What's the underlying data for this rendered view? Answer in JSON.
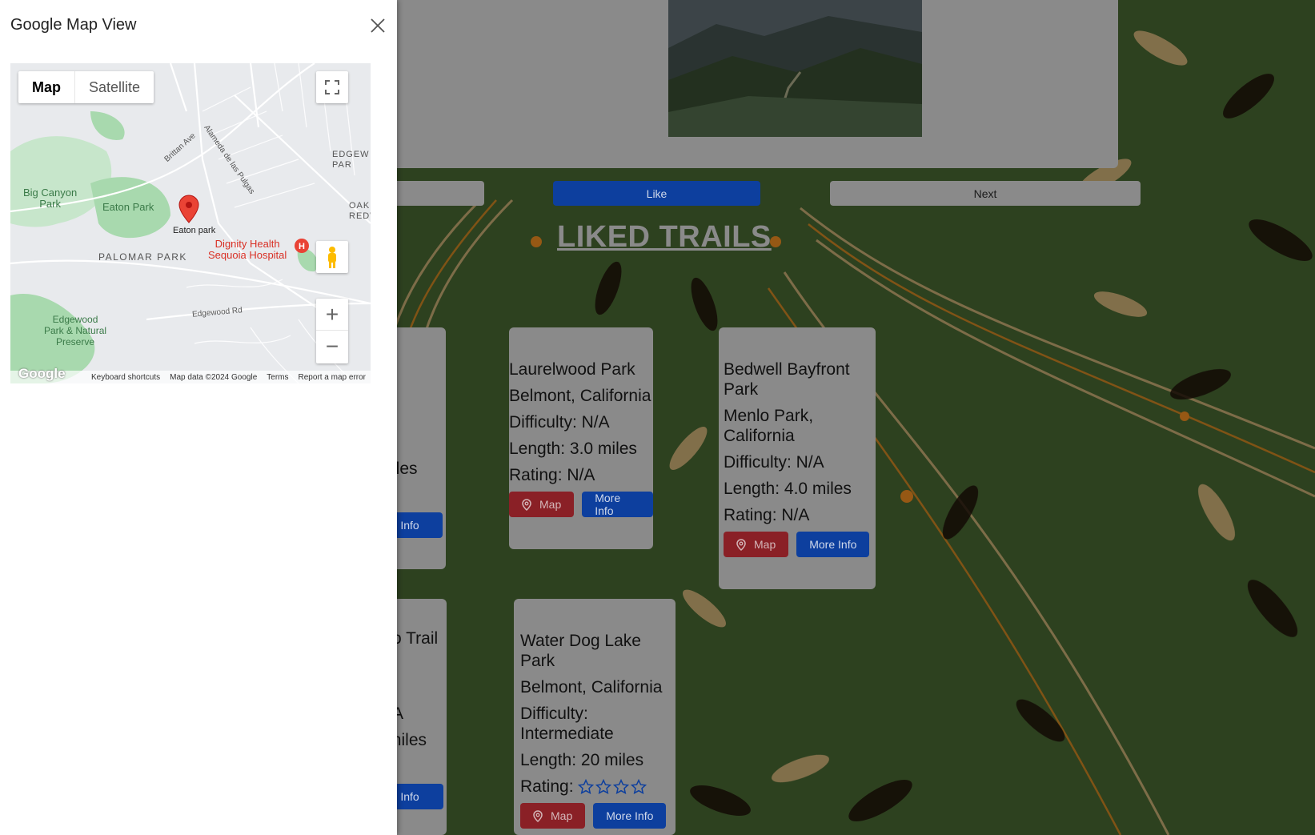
{
  "panel": {
    "title": "Google Map View"
  },
  "map": {
    "type_map": "Map",
    "type_satellite": "Satellite",
    "labels": {
      "big_canyon": "Big Canyon\nPark",
      "eaton_park_area": "Eaton Park",
      "eaton_marker": "Eaton park",
      "palomar": "PALOMAR PARK",
      "hospital": "Dignity Health\nSequoia Hospital",
      "edgewood_preserve": "Edgewood\nPark & Natural\nPreserve",
      "edgewood_rd": "Edgewood Rd",
      "brittan": "Brittan Ave",
      "alameda": "Alameda de las Pulgas",
      "edgew_par": "EDGEW\nPAR",
      "oak_redw": "OAK\nREDW"
    },
    "logo": "Google",
    "attribution": [
      "Keyboard shortcuts",
      "Map data ©2024 Google",
      "Terms",
      "Report a map error"
    ]
  },
  "controls": {
    "prev": "",
    "like": "Like",
    "next": "Next"
  },
  "heading": "LIKED TRAILS",
  "cards": [
    {
      "name": "Laurelwood Park",
      "location": "Belmont, California",
      "difficulty": "Difficulty: N/A",
      "length": "Length: 3.0 miles",
      "rating": "Rating: N/A",
      "map_btn": "Map",
      "info_btn": "More Info"
    },
    {
      "name": "Bedwell Bayfront Park",
      "location": "Menlo Park, California",
      "difficulty": "Difficulty: N/A",
      "length": "Length: 4.0 miles",
      "rating": "Rating: N/A",
      "map_btn": "Map",
      "info_btn": "More Info"
    },
    {
      "name": "Water Dog Lake Park",
      "location": "Belmont, California",
      "difficulty": "Difficulty: Intermediate",
      "length": "Length: 20 miles",
      "rating": "Rating:",
      "stars": 0,
      "max_stars": 4,
      "map_btn": "Map",
      "info_btn": "More Info"
    }
  ],
  "partial_cards": {
    "top_fragment_1": "iles",
    "top_fragment_2": "re Info",
    "bottom_fragment_1": "o Trail",
    "bottom_fragment_2": "A",
    "bottom_fragment_3": "miles",
    "bottom_fragment_4": "re Info"
  },
  "colors": {
    "like": "#0d3f9e",
    "map_btn": "#8a2026",
    "info_btn": "#0d3f9e",
    "card": "#8a8a8a"
  }
}
